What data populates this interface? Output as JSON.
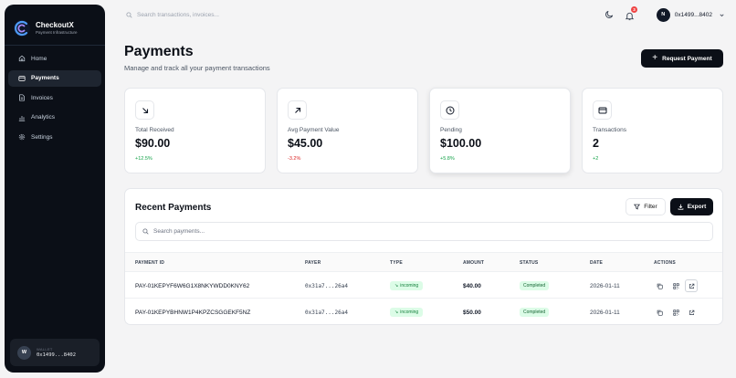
{
  "brand": {
    "name": "CheckoutX",
    "tagline": "Payment Infrastructure"
  },
  "nav": [
    {
      "label": "Home",
      "icon": "home-icon",
      "active": false
    },
    {
      "label": "Payments",
      "icon": "credit-card-icon",
      "active": true
    },
    {
      "label": "Invoices",
      "icon": "document-icon",
      "active": false
    },
    {
      "label": "Analytics",
      "icon": "bar-chart-icon",
      "active": false
    },
    {
      "label": "Settings",
      "icon": "gear-icon",
      "active": false
    }
  ],
  "sidebar_wallet": {
    "label": "WALLET",
    "avatar": "W",
    "address": "0x1499...8402"
  },
  "topbar": {
    "search_placeholder": "Search transactions, invoices...",
    "notification_count": "3",
    "account_avatar": "N",
    "account_address": "0x1499...8402"
  },
  "page": {
    "title": "Payments",
    "subtitle": "Manage and track all your payment transactions",
    "request_button": "Request Payment"
  },
  "stats": [
    {
      "icon": "arrow-down-right-icon",
      "label": "Total Received",
      "value": "$90.00",
      "change": "+12.5%",
      "trend": "up"
    },
    {
      "icon": "arrow-up-right-icon",
      "label": "Avg Payment Value",
      "value": "$45.00",
      "change": "-3.2%",
      "trend": "down"
    },
    {
      "icon": "clock-icon",
      "label": "Pending",
      "value": "$100.00",
      "change": "+5.8%",
      "trend": "up"
    },
    {
      "icon": "credit-card-icon",
      "label": "Transactions",
      "value": "2",
      "change": "+2",
      "trend": "up"
    }
  ],
  "recent": {
    "title": "Recent Payments",
    "filter_label": "Filter",
    "export_label": "Export",
    "search_placeholder": "Search payments...",
    "columns": [
      "PAYMENT ID",
      "PAYER",
      "TYPE",
      "AMOUNT",
      "STATUS",
      "DATE",
      "ACTIONS"
    ],
    "rows": [
      {
        "id": "PAY-01KEPYF6W6G1X8NKYWDD0KNY62",
        "payer": "0x31a7...26a4",
        "type": "incoming",
        "amount": "$40.00",
        "status": "Completed",
        "date": "2026-01-11"
      },
      {
        "id": "PAY-01KEPYBHNW1P4KPZCSGGEKF5NZ",
        "payer": "0x31a7...26a4",
        "type": "incoming",
        "amount": "$50.00",
        "status": "Completed",
        "date": "2026-01-11"
      }
    ]
  },
  "colors": {
    "positive": "#16a34a",
    "negative": "#dc2626",
    "dark": "#0b0f17",
    "accent_logo": "#4f9cf9"
  }
}
